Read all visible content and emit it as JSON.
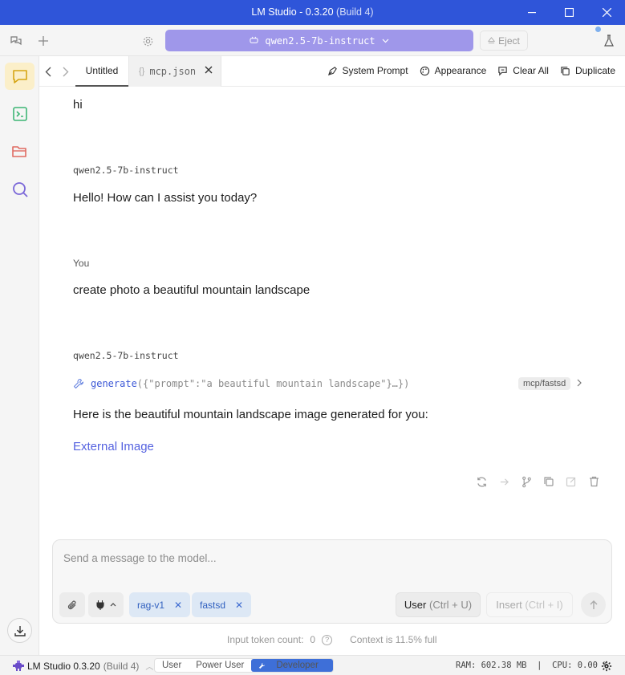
{
  "window": {
    "title": "LM Studio - 0.3.20",
    "build": "(Build 4)"
  },
  "toolbar": {
    "model_name": "qwen2.5-7b-instruct",
    "eject_label": "Eject"
  },
  "tabs": {
    "active_label": "Untitled",
    "mcp_label": "mcp.json"
  },
  "actions": {
    "system_prompt": "System Prompt",
    "appearance": "Appearance",
    "clear_all": "Clear All",
    "duplicate": "Duplicate"
  },
  "chat": {
    "msg1_text": "hi",
    "msg2_sender": "qwen2.5-7b-instruct",
    "msg2_text": "Hello! How can I assist you today?",
    "msg3_sender": "You",
    "msg3_text": "create photo a beautiful mountain landscape",
    "msg4_sender": "qwen2.5-7b-instruct",
    "tool_fn": "generate",
    "tool_args": "({\"prompt\":\"a beautiful mountain landscape\"}…})",
    "tool_badge": "mcp/fastsd",
    "msg4_text": "Here is the beautiful mountain landscape image generated for you:",
    "link_text": "External Image"
  },
  "composer": {
    "placeholder": "Send a message to the model...",
    "chip1": "rag-v1",
    "chip2": "fastsd",
    "user_label": "User",
    "user_kbd": "(Ctrl + U)",
    "insert_label": "Insert",
    "insert_kbd": "(Ctrl + I)"
  },
  "footer": {
    "token_count_label": "Input token count:",
    "token_count_value": "0",
    "context_text": "Context is 11.5% full"
  },
  "statusbar": {
    "app_name": "LM Studio 0.3.20",
    "build": "(Build 4)",
    "mode_user": "User",
    "mode_power": "Power User",
    "mode_dev": "Developer",
    "stats": "RAM: 602.38 MB  |  CPU: 0.00 %"
  },
  "colors": {
    "titlebar": "#2f55d9",
    "model_pill": "#9f97ea",
    "link": "#5562e0",
    "developer": "#3e6fd8",
    "active_sidebar": "#fbefc9"
  }
}
